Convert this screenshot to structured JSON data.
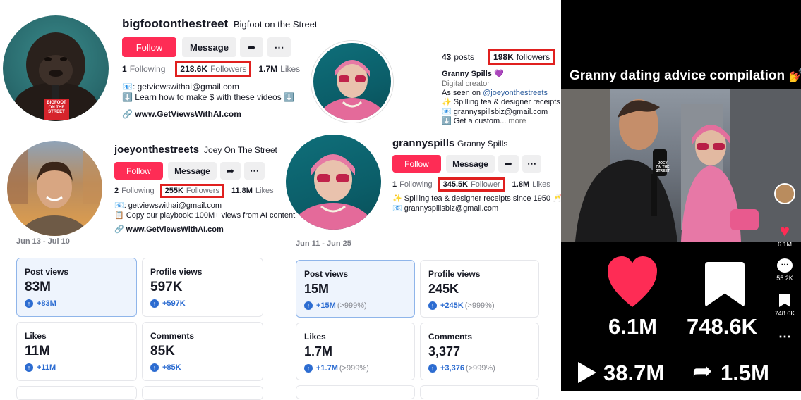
{
  "profile1": {
    "username": "bigfootonthestreet",
    "nickname": "Bigfoot on the Street",
    "follow_label": "Follow",
    "message_label": "Message",
    "following_count": "1",
    "following_label": "Following",
    "followers_count": "218.6K",
    "followers_label": "Followers",
    "likes_count": "1.7M",
    "likes_label": "Likes",
    "bio_line1": "📧: getviewswithai@gmail.com",
    "bio_line2": "⬇️ Learn how to make $ with these videos ⬇️",
    "link": "www.GetViewsWithAI.com",
    "avatar_caption": "BIGFOOT ON THE STREET"
  },
  "profile2": {
    "username": "joeyonthestreets",
    "nickname": "Joey On The Street",
    "follow_label": "Follow",
    "message_label": "Message",
    "following_count": "2",
    "following_label": "Following",
    "followers_count": "255K",
    "followers_label": "Followers",
    "likes_count": "11.8M",
    "likes_label": "Likes",
    "bio_line1": "📧: getviewswithai@gmail.com",
    "bio_line2": "📋 Copy our playbook: 100M+ views from AI content",
    "link": "www.GetViewsWithAI.com"
  },
  "profile3": {
    "posts_count": "43",
    "posts_label": "posts",
    "followers_count": "198K",
    "followers_label": "followers",
    "name": "Granny Spills 💜",
    "category": "Digital creator",
    "seen_prefix": "As seen on ",
    "seen_handle": "@joeyonthestreets",
    "bio_line1": "✨ Spilling tea & designer receipts",
    "bio_line2": "📧 grannyspillsbiz@gmail.com",
    "bio_line3": "⬇️ Get a custom...",
    "more_label": "more"
  },
  "profile4": {
    "username": "grannyspills",
    "nickname": "Granny Spills",
    "follow_label": "Follow",
    "message_label": "Message",
    "following_count": "1",
    "following_label": "Following",
    "followers_count": "345.5K",
    "followers_label": "Follower",
    "likes_count": "1.8M",
    "likes_label": "Likes",
    "bio_line1": "✨ Spilling tea & designer receipts since 1950 🥂",
    "bio_line2": "📧 grannyspillsbiz@gmail.com"
  },
  "analytics_left": {
    "date_range": "Jun 13 - Jul 10",
    "cards": [
      {
        "title": "Post views",
        "value": "83M",
        "delta": "+83M",
        "pct": ""
      },
      {
        "title": "Profile views",
        "value": "597K",
        "delta": "+597K",
        "pct": ""
      },
      {
        "title": "Likes",
        "value": "11M",
        "delta": "+11M",
        "pct": ""
      },
      {
        "title": "Comments",
        "value": "85K",
        "delta": "+85K",
        "pct": ""
      }
    ]
  },
  "analytics_right": {
    "date_range": "Jun 11 - Jun 25",
    "cards": [
      {
        "title": "Post views",
        "value": "15M",
        "delta": "+15M",
        "pct": "(>999%)"
      },
      {
        "title": "Profile views",
        "value": "245K",
        "delta": "+245K",
        "pct": "(>999%)"
      },
      {
        "title": "Likes",
        "value": "1.7M",
        "delta": "+1.7M",
        "pct": "(>999%)"
      },
      {
        "title": "Comments",
        "value": "3,377",
        "delta": "+3,376",
        "pct": "(>999%)"
      }
    ]
  },
  "video": {
    "title": "Granny dating advice compilation 💅",
    "mic_text": "JOEY ON THE STREET",
    "side_likes": "6.1M",
    "side_comments": "55.2K",
    "side_saves": "748.6K",
    "likes": "6.1M",
    "saves": "748.6K",
    "plays": "38.7M",
    "shares": "1.5M"
  },
  "colors": {
    "follow": "#fe2c55",
    "highlight": "#e0201f",
    "accent_blue": "#2c6cd1"
  }
}
